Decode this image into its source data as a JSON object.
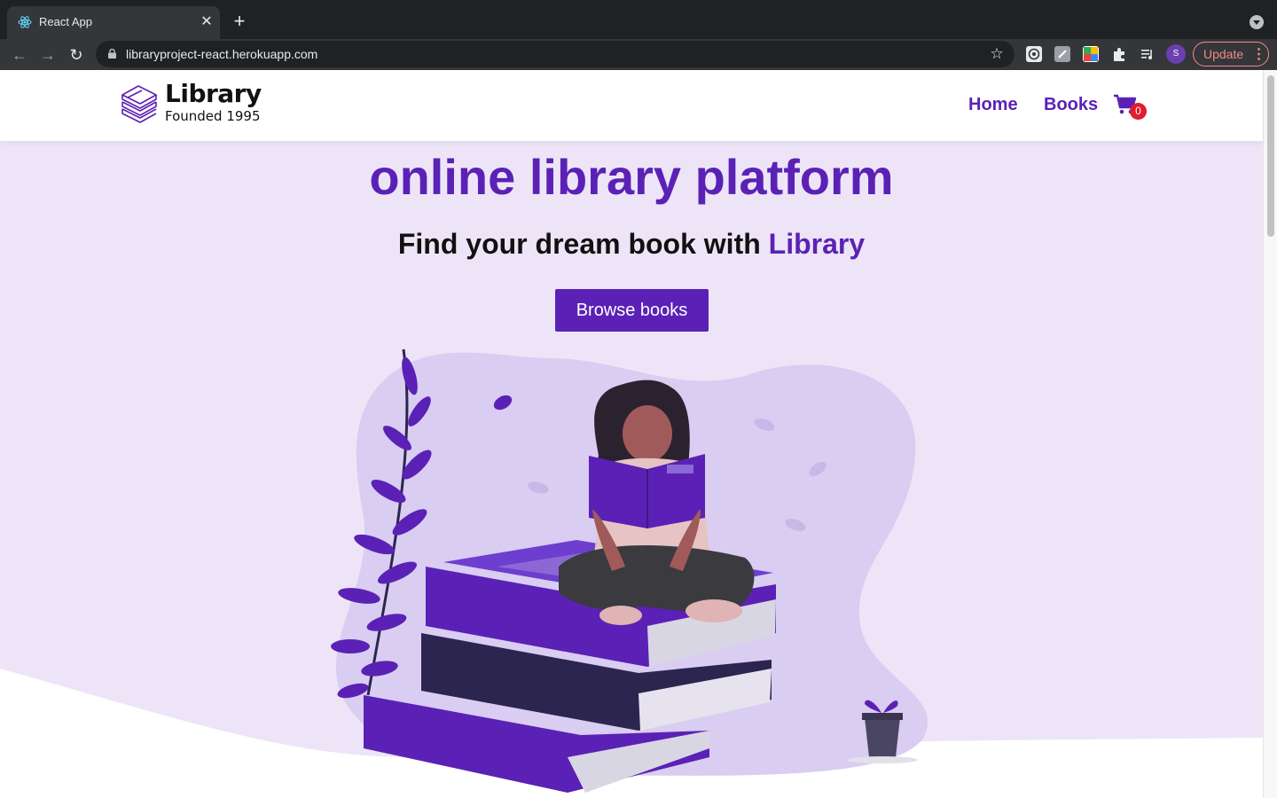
{
  "browser": {
    "tab_title": "React App",
    "url": "libraryproject-react.herokuapp.com",
    "profile_initial": "S",
    "update_label": "Update",
    "icons": [
      "react-favicon",
      "close-icon",
      "plus-icon",
      "tab-search-icon",
      "back-icon",
      "forward-icon",
      "reload-icon",
      "lock-icon",
      "star-icon",
      "extension-icon",
      "puzzle-icon",
      "media-icon",
      "more-vert-icon"
    ]
  },
  "site": {
    "logo": {
      "title": "Library",
      "subtitle": "Founded 1995"
    },
    "nav": {
      "home": "Home",
      "books": "Books",
      "cart_count": "0"
    },
    "hero": {
      "title": "online library platform",
      "subtitle_prefix": "Find your dream book with ",
      "subtitle_accent": "Library",
      "cta": "Browse books"
    },
    "colors": {
      "accent": "#5b21b6",
      "hero_bg": "#ede5f7",
      "badge": "#e11d2e",
      "dark_book": "#2b2550"
    }
  }
}
